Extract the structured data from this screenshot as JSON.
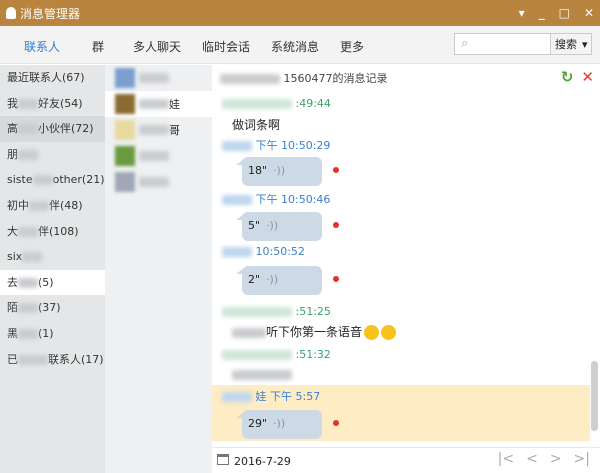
{
  "window": {
    "title": "消息管理器"
  },
  "tabs": [
    "联系人",
    "群",
    "多人聊天",
    "临时会话",
    "系统消息",
    "更多"
  ],
  "search": {
    "placeholder": "",
    "button": "搜索"
  },
  "groups": [
    {
      "pre": "最近联系人(67)",
      "post": ""
    },
    {
      "pre": "我",
      "post": "好友(54)"
    },
    {
      "pre": "高",
      "post": "小伙伴(72)"
    },
    {
      "pre": "朋",
      "post": ""
    },
    {
      "pre": "siste",
      "post": "other(21)"
    },
    {
      "pre": "初中",
      "post": "伴(48)"
    },
    {
      "pre": "大",
      "post": "伴(108)"
    },
    {
      "pre": "six",
      "post": ""
    },
    {
      "pre": "去",
      "post": "(5)"
    },
    {
      "pre": "陌",
      "post": "(37)"
    },
    {
      "pre": "黑",
      "post": "(1)"
    },
    {
      "pre": "已",
      "post": "联系人(17)"
    }
  ],
  "contacts": [
    {
      "name": ""
    },
    {
      "name": "娃"
    },
    {
      "name": "哥"
    },
    {
      "name": ""
    },
    {
      "name": ""
    }
  ],
  "chat": {
    "header": "1560477的消息记录",
    "messages": [
      {
        "time": ":49:44",
        "text": "做词条啊"
      },
      {
        "time": "下午 10:50:29",
        "voice": "18\""
      },
      {
        "time": "下午 10:50:46",
        "voice": "5\""
      },
      {
        "time": "10:50:52",
        "voice": "2\""
      },
      {
        "time": ":51:25",
        "text": "听下你第一条语音"
      },
      {
        "time": ":51:32"
      },
      {
        "time": "娃 下午 5:57",
        "voice": "29\""
      }
    ],
    "date": "2016-7-29"
  }
}
